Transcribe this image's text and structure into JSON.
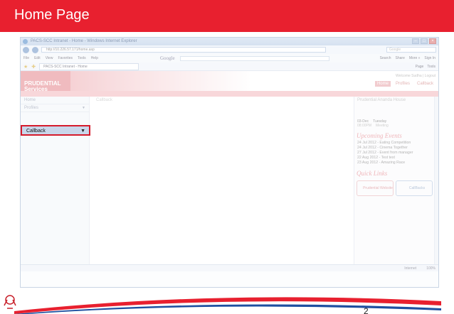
{
  "slide": {
    "title": "Home Page",
    "page_number": "2"
  },
  "browser": {
    "window_title": "PACS-SCC Intranet - Home - Windows Internet Explorer",
    "address": "http://10.226.57.171/home.asp",
    "search_placeholder": "Google",
    "menu": [
      "File",
      "Edit",
      "View",
      "Favorites",
      "Tools",
      "Help"
    ],
    "google_label": "Google",
    "menu_right": [
      "Search",
      "Share",
      "More »",
      "Sign In"
    ],
    "tab_label": "PACS-SCC Intranet - Home",
    "fav_right": [
      "Page",
      "Tools"
    ],
    "status_left": "",
    "status_zone": "Internet",
    "status_zoom": "100%"
  },
  "site": {
    "logo_line1": "PRUDENTIAL",
    "logo_line2": "Services",
    "welcome": "Welcome Sudha | Logout",
    "nav": [
      "Home",
      "Profiles",
      "Callback"
    ],
    "left_nav": [
      "Home",
      "Profiles",
      "Callback"
    ],
    "crumb": "Callback",
    "right_head": "Prudential Ananda House"
  },
  "calendar": {
    "date": "03-Dec",
    "day": "Tuesday",
    "sub_a": "08:00PM",
    "sub_b": "Meeting"
  },
  "events": {
    "heading": "Upcoming Events",
    "items": [
      "24 Jul 2012 - Eating Competition",
      "24 Jul 2012 - Cinema Together",
      "27 Jul 2012 - Event from manager",
      "22 Aug 2012 - Test test",
      "23 Aug 2012 - Amazing Race"
    ]
  },
  "quick_links": {
    "heading": "Quick Links",
    "items": [
      "Prudential Website",
      "CallBacks"
    ]
  },
  "highlight": {
    "label": "Callback"
  }
}
